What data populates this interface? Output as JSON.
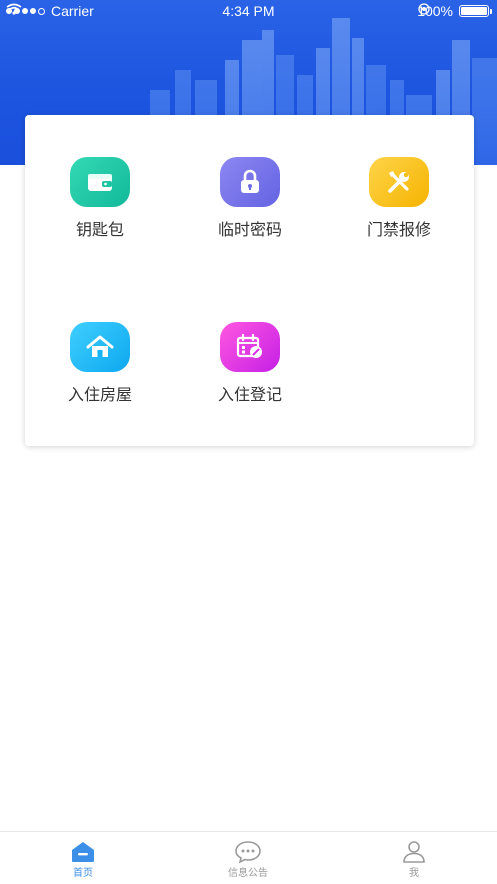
{
  "status_bar": {
    "carrier": "Carrier",
    "time": "4:34 PM",
    "battery": "100%",
    "battery_level": 1.0
  },
  "colors": {
    "hero_blue": "#1d55e0",
    "tab_active": "#3b8fe6",
    "tab_inactive": "#9a9a9a"
  },
  "menu": {
    "items": [
      {
        "label": "钥匙包",
        "icon": "wallet-icon",
        "color_from": "#34d9b4",
        "color_to": "#12b99a"
      },
      {
        "label": "临时密码",
        "icon": "lock-icon",
        "color_from": "#8c87f2",
        "color_to": "#6463e2"
      },
      {
        "label": "门禁报修",
        "icon": "tools-icon",
        "color_from": "#ffd54a",
        "color_to": "#f5b300"
      },
      {
        "label": "入住房屋",
        "icon": "home-icon",
        "color_from": "#3fcfff",
        "color_to": "#0ea8ef"
      },
      {
        "label": "入住登记",
        "icon": "calendar-icon",
        "color_from": "#ff57e0",
        "color_to": "#c520e6"
      }
    ]
  },
  "tab_bar": {
    "tabs": [
      {
        "label": "首页",
        "icon": "home-icon",
        "active": true
      },
      {
        "label": "信息公告",
        "icon": "message-icon",
        "active": false
      },
      {
        "label": "我",
        "icon": "user-icon",
        "active": false
      }
    ]
  }
}
